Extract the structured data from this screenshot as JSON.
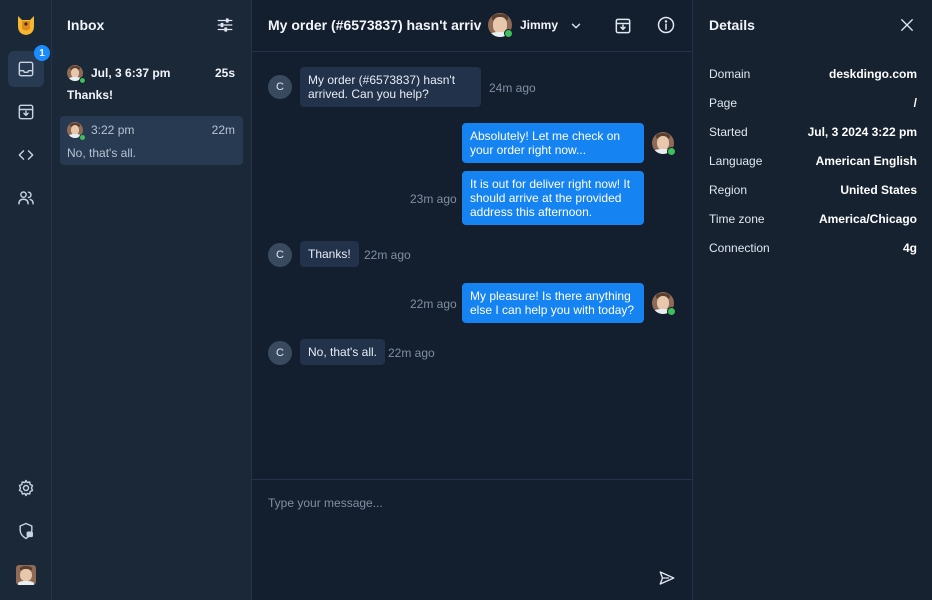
{
  "rail": {
    "inbox_badge": "1"
  },
  "inbox": {
    "title": "Inbox",
    "conversations": [
      {
        "time": "Jul, 3 6:37 pm",
        "age": "25s",
        "preview": "Thanks!"
      },
      {
        "time": "3:22 pm",
        "age": "22m",
        "preview": "No, that's all."
      }
    ]
  },
  "chat": {
    "title": "My order (#6573837) hasn't arriv",
    "assignee": "Jimmy",
    "customer_initial": "C",
    "messages": [
      {
        "direction": "in",
        "text": "My order (#6573837) hasn't arrived. Can you help?",
        "time": "24m ago"
      },
      {
        "direction": "out",
        "text": "Absolutely! Let me check on your order right now...",
        "time": ""
      },
      {
        "direction": "out",
        "text": "It is out for deliver right now! It should arrive at the provided address this afternoon.",
        "time": "23m ago"
      },
      {
        "direction": "in",
        "text": "Thanks!",
        "time": "22m ago"
      },
      {
        "direction": "out",
        "text": "My pleasure! Is there anything else I can help you with today?",
        "time": "22m ago"
      },
      {
        "direction": "in",
        "text": "No, that's all.",
        "time": "22m ago"
      }
    ],
    "composer_placeholder": "Type your message..."
  },
  "details": {
    "title": "Details",
    "rows": [
      {
        "key": "Domain",
        "value": "deskdingo.com"
      },
      {
        "key": "Page",
        "value": "/"
      },
      {
        "key": "Started",
        "value": "Jul, 3 2024 3:22 pm"
      },
      {
        "key": "Language",
        "value": "American English"
      },
      {
        "key": "Region",
        "value": "United States"
      },
      {
        "key": "Time zone",
        "value": "America/Chicago"
      },
      {
        "key": "Connection",
        "value": "4g"
      }
    ]
  },
  "colors": {
    "accent": "#1683f2",
    "online": "#3fbf5a",
    "logo": "#f5b82e"
  }
}
